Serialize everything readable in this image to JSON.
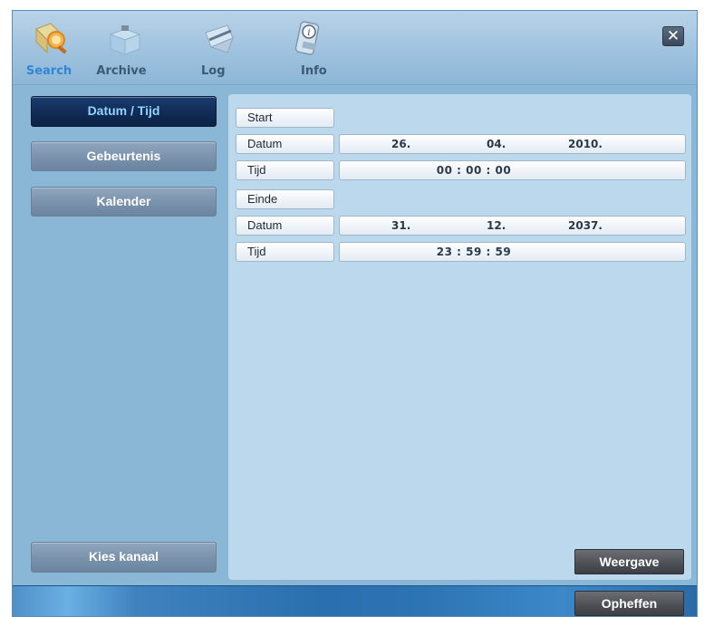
{
  "toolbar": {
    "items": [
      {
        "label": "Search",
        "icon": "search-icon"
      },
      {
        "label": "Archive",
        "icon": "archive-icon"
      },
      {
        "label": "Log",
        "icon": "log-icon"
      },
      {
        "label": "Info",
        "icon": "info-icon"
      }
    ],
    "close_label": "✕",
    "active_color": "#2f86d6"
  },
  "sidebar": {
    "items": [
      {
        "label": "Datum / Tijd"
      },
      {
        "label": "Gebeurtenis"
      },
      {
        "label": "Kalender"
      }
    ],
    "select_channel_label": "Kies kanaal"
  },
  "form": {
    "start": {
      "heading": "Start",
      "date_label": "Datum",
      "day": "26.",
      "month": "04.",
      "year": "2010.",
      "time_label": "Tijd",
      "time": "00 : 00 : 00"
    },
    "end": {
      "heading": "Einde",
      "date_label": "Datum",
      "day": "31.",
      "month": "12.",
      "year": "2037.",
      "time_label": "Tijd",
      "time": "23 : 59 : 59"
    }
  },
  "buttons": {
    "view_label": "Weergave",
    "cancel_label": "Opheffen"
  }
}
